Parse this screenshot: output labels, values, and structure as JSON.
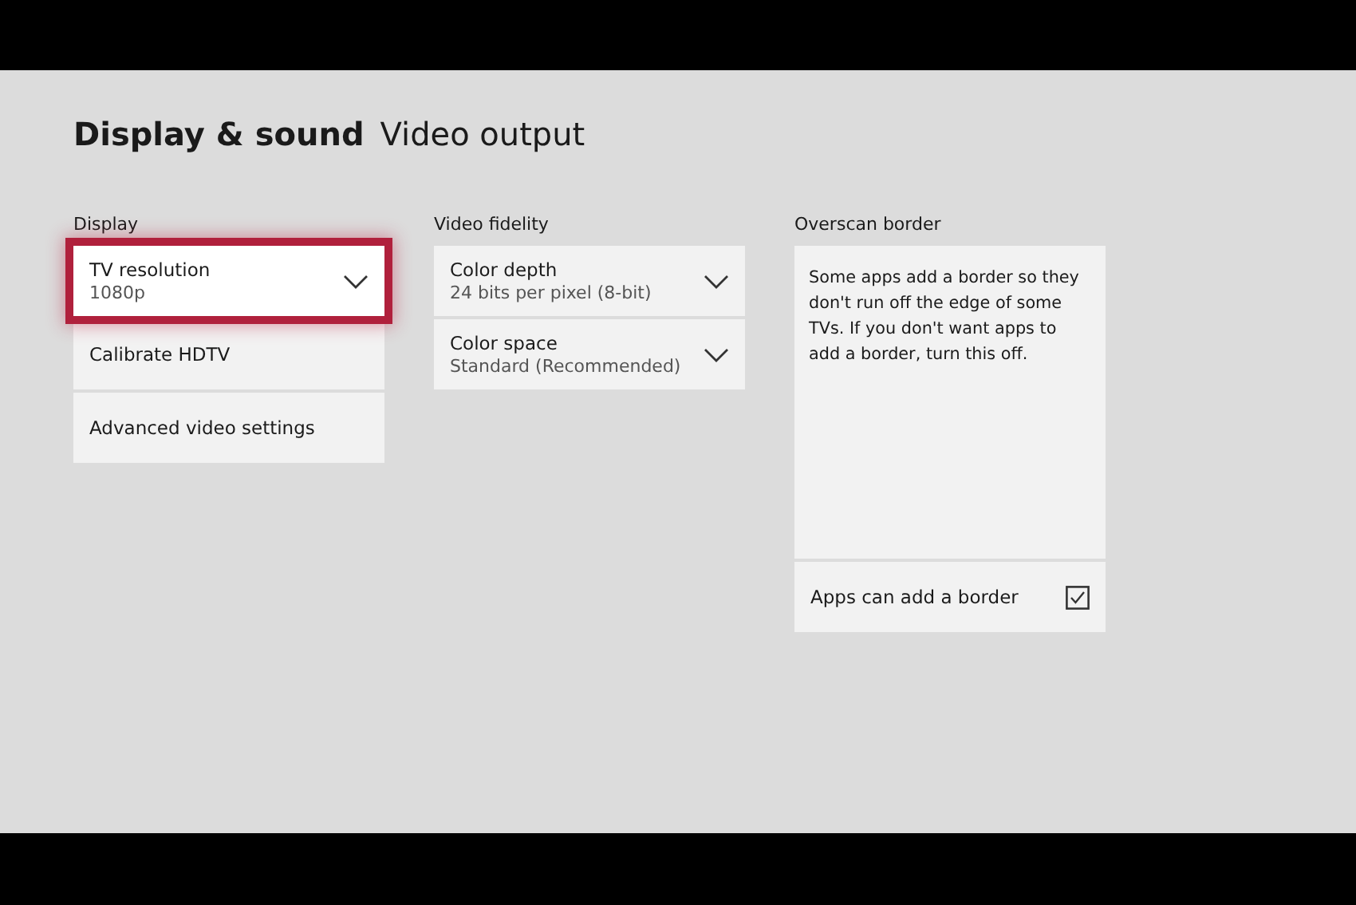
{
  "header": {
    "title": "Display & sound",
    "subtitle": "Video output"
  },
  "sections": [
    {
      "label": "Display",
      "items": [
        {
          "kind": "dropdown",
          "label": "TV resolution",
          "value": "1080p",
          "selected": true
        },
        {
          "kind": "link",
          "label": "Calibrate HDTV",
          "selected": false
        },
        {
          "kind": "link",
          "label": "Advanced video settings",
          "selected": false
        }
      ]
    },
    {
      "label": "Video fidelity",
      "items": [
        {
          "kind": "dropdown",
          "label": "Color depth",
          "value": "24 bits per pixel (8-bit)",
          "selected": false
        },
        {
          "kind": "dropdown",
          "label": "Color space",
          "value": "Standard (Recommended)",
          "selected": false
        }
      ]
    },
    {
      "label": "Overscan border",
      "items": [
        {
          "kind": "description",
          "text": "Some apps add a border so they don't run off the edge of some TVs. If you don't want apps to add a border, turn this off."
        },
        {
          "kind": "checkbox",
          "label": "Apps can add a border",
          "checked": true,
          "selected": false
        }
      ]
    }
  ]
}
